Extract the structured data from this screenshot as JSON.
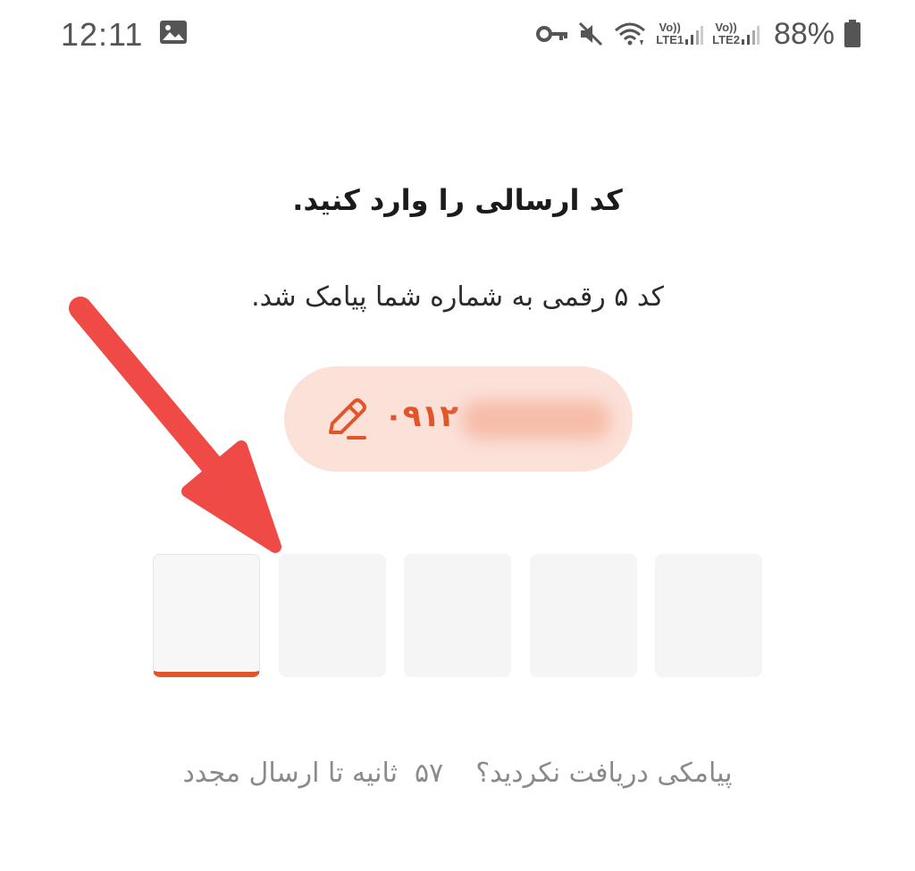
{
  "status_bar": {
    "time": "12:11",
    "battery_percent": "88%",
    "sim1_label_top": "Vo))",
    "sim1_label_bottom": "LTE1",
    "sim2_label_top": "Vo))",
    "sim2_label_bottom": "LTE2",
    "icons": [
      "gallery-icon",
      "vpn-key-icon",
      "mute-icon",
      "wifi-icon",
      "signal-icon",
      "battery-icon"
    ]
  },
  "main": {
    "title": "کد ارسالی را وارد کنید.",
    "subtitle": "کد ۵ رقمی به شماره شما پیامک شد.",
    "phone_number_visible": "۰۹۱۲",
    "edit_icon": "pencil-edit-icon",
    "otp_box_count": 5,
    "resend": {
      "question": "پیامکی دریافت نکردید؟",
      "seconds": "۵۷",
      "suffix": "ثانیه تا ارسال مجدد"
    }
  },
  "annotation": {
    "icon": "red-arrow-icon"
  },
  "colors": {
    "accent": "#e2552a",
    "pill_bg": "#fbe1d8",
    "otp_bg": "#f5f5f5",
    "muted_text": "#8a8a8a",
    "arrow": "#ef4a45"
  }
}
